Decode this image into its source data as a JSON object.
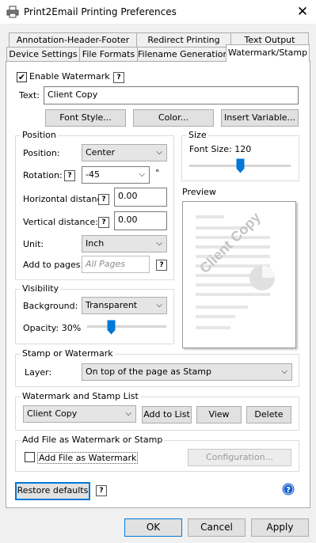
{
  "window": {
    "title": "Print2Email Printing Preferences",
    "close_glyph": "✕"
  },
  "tabs_row1": [
    "Annotation-Header-Footer",
    "Redirect Printing",
    "Text Output"
  ],
  "tabs_row2": [
    "Device Settings",
    "File Formats",
    "Filename Generation",
    "Watermark/Stamp"
  ],
  "enable_watermark": {
    "label": "Enable Watermark",
    "checked": true,
    "check_glyph": "✔"
  },
  "help_glyph": "?",
  "text_field": {
    "label": "Text:",
    "value": "Client Copy"
  },
  "buttons": {
    "font_style": "Font Style...",
    "color": "Color...",
    "insert_variable": "Insert Variable..."
  },
  "position": {
    "title": "Position",
    "position_label": "Position:",
    "position_value": "Center",
    "rotation_label": "Rotation:",
    "rotation_value": "-45",
    "degree_symbol": "°",
    "hdist_label": "Horizontal distance:",
    "hdist_value": "0.00",
    "vdist_label": "Vertical distance:",
    "vdist_value": "0.00",
    "unit_label": "Unit:",
    "unit_value": "Inch",
    "pages_label": "Add to pages:",
    "pages_placeholder": "All Pages"
  },
  "size": {
    "title": "Size",
    "font_size_label": "Font Size: 120",
    "slider_fraction": 0.5
  },
  "preview": {
    "title": "Preview",
    "watermark_text": "Client Copy"
  },
  "visibility": {
    "title": "Visibility",
    "background_label": "Background:",
    "background_value": "Transparent",
    "opacity_label": "Opacity: 30%",
    "slider_fraction": 0.3
  },
  "stamp": {
    "title": "Stamp or Watermark",
    "layer_label": "Layer:",
    "layer_value": "On top of the page as Stamp"
  },
  "list": {
    "title": "Watermark and Stamp List",
    "selected": "Client Copy",
    "add": "Add to List",
    "view": "View",
    "delete": "Delete"
  },
  "add_file": {
    "title": "Add File as Watermark or Stamp",
    "checkbox_label": "Add File as Watermark",
    "checked": false,
    "configuration": "Configuration..."
  },
  "restore": "Restore defaults",
  "dialog_buttons": {
    "ok": "OK",
    "cancel": "Cancel",
    "apply": "Apply"
  },
  "colors": {
    "accent": "#0078d7",
    "panel": "#ffffff",
    "dialog": "#f0f0f0"
  },
  "icons": {
    "app": "printer-icon",
    "info": "info-circle-icon",
    "dropdown": "chevron-down-icon"
  }
}
